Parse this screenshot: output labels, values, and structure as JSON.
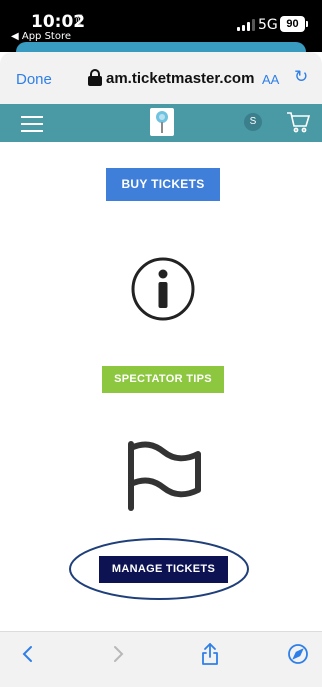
{
  "status_bar": {
    "time": "10:02",
    "back_app": "◀ App Store",
    "network": "5G",
    "battery": "90"
  },
  "browser": {
    "done_label": "Done",
    "url": "am.ticketmaster.com",
    "text_size_label": "AA"
  },
  "site_nav": {
    "avatar_initial": "S"
  },
  "content": {
    "buy_tickets_label": "BUY TICKETS",
    "spectator_tips_label": "SPECTATOR TIPS",
    "manage_tickets_label": "MANAGE TICKETS"
  },
  "colors": {
    "nav_teal": "#4a9aa6",
    "buy_blue": "#3f7fd9",
    "tips_green": "#8dc63f",
    "manage_navy": "#0c1252",
    "link_blue": "#2f7fe8"
  },
  "icons": [
    "menu-icon",
    "logo-icon",
    "cart-icon",
    "info-icon",
    "flag-icon",
    "back-icon",
    "forward-icon",
    "share-icon",
    "compass-icon"
  ]
}
